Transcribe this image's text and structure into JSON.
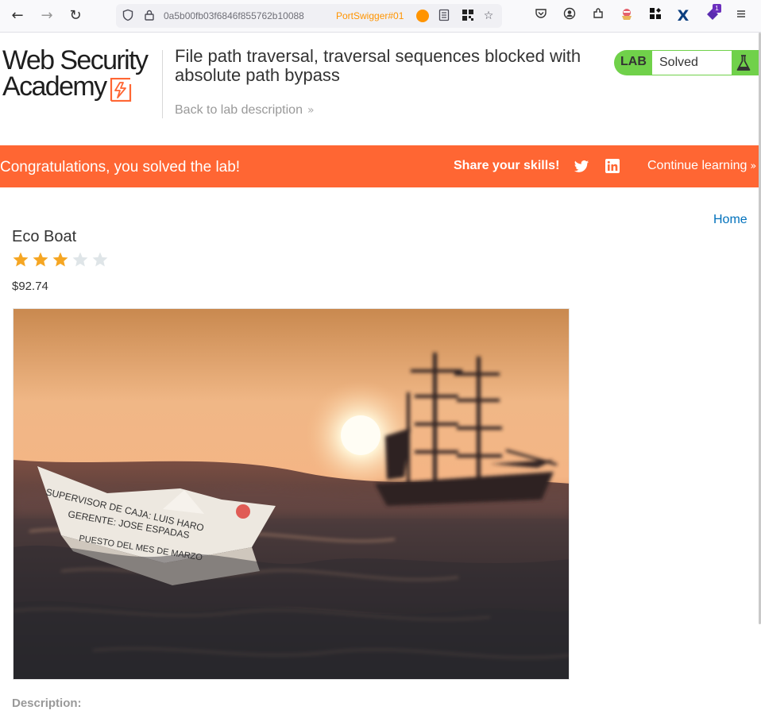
{
  "browser": {
    "url": "0a5b00fb03f6846f855762b10088",
    "container_label": "PortSwigger#01",
    "extension_badge_count": "1",
    "icons": [
      "back-arrow-icon",
      "forward-arrow-icon",
      "reload-icon",
      "shield-icon",
      "lock-icon",
      "reader-view-icon",
      "qr-code-icon",
      "bookmark-star-icon",
      "pocket-icon",
      "account-icon",
      "extensions-icon",
      "extension-a-icon",
      "extension-grid-icon",
      "extension-x-icon",
      "extension-badge-icon",
      "menu-icon"
    ]
  },
  "header": {
    "logo_line1": "Web Security",
    "logo_line2": "Academy",
    "lab_title": "File path traversal, traversal sequences blocked with absolute path bypass",
    "back_link": "Back to lab description",
    "back_chevron": "»",
    "lab_badge": "LAB",
    "status": "Solved",
    "status_color": "#70d14a"
  },
  "banner": {
    "congrats": "Congratulations, you solved the lab!",
    "share": "Share your skills!",
    "continue": "Continue learning",
    "continue_chevron": "»",
    "color": "#ff6633"
  },
  "product": {
    "home_link": "Home",
    "title": "Eco Boat",
    "rating": 3,
    "rating_max": 5,
    "price": "$92.74",
    "description_label": "Description:",
    "image_text_lines": [
      "SUPERVISOR DE CAJA: LUIS HARO",
      "GERENTE: JOSE ESPADAS",
      "PUESTO DEL MES DE MARZO"
    ]
  }
}
